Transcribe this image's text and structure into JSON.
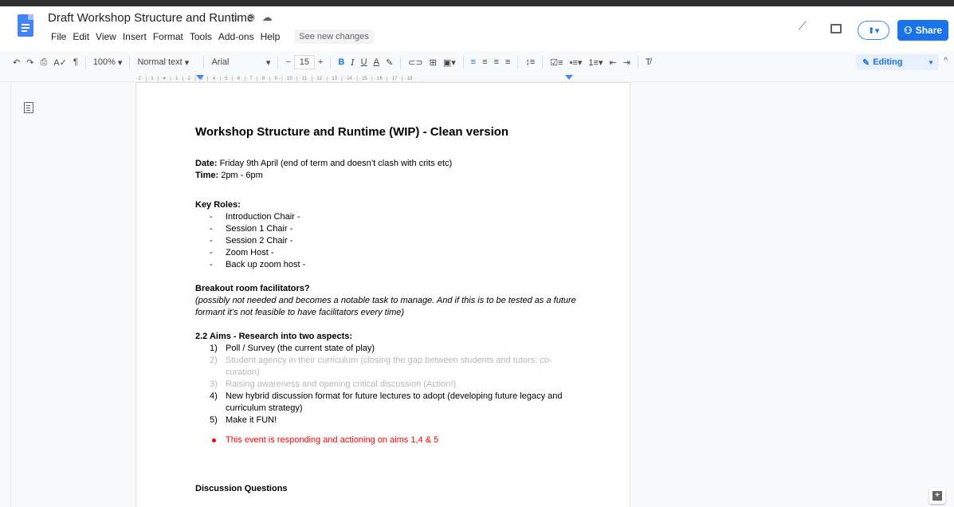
{
  "window": {
    "title": "Draft Workshop Structure and Runtime"
  },
  "menu": {
    "items": [
      "File",
      "Edit",
      "View",
      "Insert",
      "Format",
      "Tools",
      "Add-ons",
      "Help"
    ],
    "see_new_changes": "See new changes"
  },
  "header": {
    "present_label": "⬆▾",
    "share_label": "Share"
  },
  "toolbar": {
    "zoom": "100%",
    "style": "Normal text",
    "font": "Arial",
    "font_size": "15",
    "bold": "B",
    "italic": "I",
    "underline": "U",
    "text_color": "A",
    "mode": "Editing"
  },
  "ruler": {
    "ticks": "· 2 · | · 1 · | · ▾ · | · 1 · | · 2 · | · 3 · | · 4 · | · 5 · | · 6 · | · 7 · | · 8 · | · 9 · | · 10 · | · 11 · | · 12 · | · 13 · | · 14 · | · 15 · | · 16 · | · 17 · | · 18 ·"
  },
  "document": {
    "heading": "Workshop Structure and Runtime (WIP) - Clean version",
    "date_label": "Date:",
    "date_value": " Friday 9th April (end of term and doesn’t clash with crits etc)",
    "time_label": "Time:",
    "time_value": " 2pm - 6pm",
    "key_roles_heading": "Key Roles:",
    "key_roles": [
      "Introduction Chair -",
      "Session 1 Chair -",
      "Session 2 Chair -",
      "Zoom Host -",
      "Back up zoom host -"
    ],
    "breakout_heading": "Breakout room facilitators?",
    "breakout_note": "(possibly not needed and becomes a notable task to manage. And if this is to be tested as a future formant it’s not feasible to have facilitators every time)",
    "aims_heading": "2.2 Aims - Research into two aspects:",
    "aims": [
      {
        "n": "1)",
        "text": "Poll / Survey (the current state of play)"
      },
      {
        "n": "2)",
        "text": "Student agency in their curriculum (closing the gap between students and tutors; co-curation)"
      },
      {
        "n": "3)",
        "text": "Raising awareness and opening critical discussion (Action!)"
      },
      {
        "n": "4)",
        "text": "New hybrid discussion format for future lectures to adopt (developing future legacy and curriculum strategy)"
      },
      {
        "n": "5)",
        "text": "Make it FUN!"
      }
    ],
    "event_note": "This event is responding and actioning on aims 1,4 & 5",
    "discussion_heading": "Discussion Questions"
  },
  "colors": {
    "accent": "#1a73e8",
    "faded_text": "#b7b7b7",
    "highlight_red": "#ff0000"
  }
}
